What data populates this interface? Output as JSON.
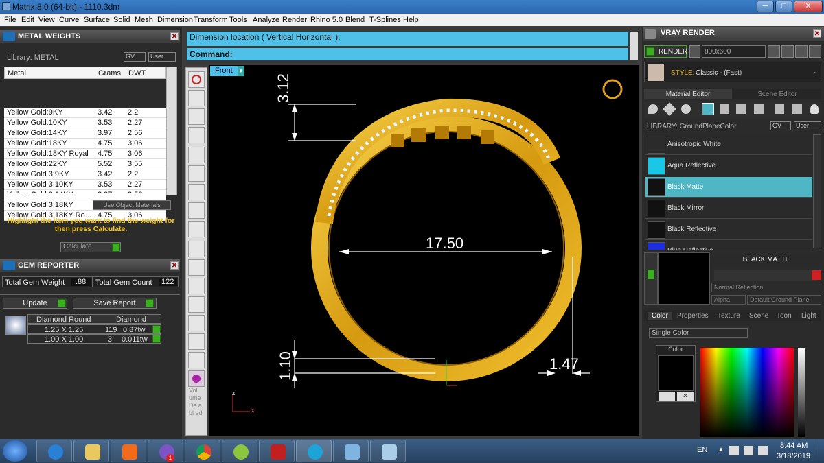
{
  "window": {
    "title": "Matrix 8.0 (64-bit) - 1110.3dm",
    "min": "─",
    "max": "□",
    "close": "✕"
  },
  "menu": [
    "File",
    "Edit",
    "View",
    "Curve",
    "Surface",
    "Solid",
    "Mesh",
    "Dimension",
    "Transform",
    "Tools",
    "Analyze",
    "Render",
    "Rhino 5.0",
    "Blend",
    "T-Splines",
    "Help"
  ],
  "metal_weights": {
    "title": "METAL WEIGHTS",
    "library": "Library: METAL",
    "gv": "GV",
    "user": "User",
    "columns": [
      "Metal",
      "Grams",
      "DWT"
    ],
    "rows": [
      [
        "Yellow Gold:9KY",
        "3.42",
        "2.2"
      ],
      [
        "Yellow Gold:10KY",
        "3.53",
        "2.27"
      ],
      [
        "Yellow Gold:14KY",
        "3.97",
        "2.56"
      ],
      [
        "Yellow Gold:18KY",
        "4.75",
        "3.06"
      ],
      [
        "Yellow Gold:18KY Royal",
        "4.75",
        "3.06"
      ],
      [
        "Yellow Gold:22KY",
        "5.52",
        "3.55"
      ],
      [
        "Yellow Gold 3:9KY",
        "3.42",
        "2.2"
      ],
      [
        "Yellow Gold 3:10KY",
        "3.53",
        "2.27"
      ],
      [
        "Yellow Gold 3:14KY",
        "3.97",
        "2.56"
      ],
      [
        "Yellow Gold 3:18KY",
        "4.75",
        "3.06"
      ],
      [
        "Yellow Gold 3:18KY Ro...",
        "4.75",
        "3.06"
      ]
    ],
    "use_object": "Use Object Materials",
    "hint": "Highlight the item you want to find the weight for then press Calculate.",
    "calculate": "Calculate"
  },
  "gem_reporter": {
    "title": "GEM REPORTER",
    "total_weight_label": "Total Gem Weight",
    "total_weight": ".88",
    "total_count_label": "Total Gem Count",
    "total_count": "122",
    "update": "Update",
    "save": "Save Report",
    "col1": "Diamond Round",
    "col2": "Diamond",
    "rows": [
      [
        "1.25 X 1.25",
        "119",
        "0.87tw"
      ],
      [
        "1.00 X 1.00",
        "3",
        "0.011tw"
      ]
    ]
  },
  "command": {
    "prompt": "Dimension location ( Vertical  Horizontal ):",
    "label": "Command:"
  },
  "viewport": {
    "name": "Front",
    "dims": {
      "top": "3.12",
      "inner": "17.50",
      "bottom": "1.10",
      "side": "1.47"
    },
    "axis_z": "z",
    "axis_x": "x"
  },
  "side_toolbar": {
    "volume_text": "Vol ume De abl ed"
  },
  "vray": {
    "title": "VRAY RENDER",
    "render": "RENDER",
    "resolution": "800x600",
    "style_label": "STYLE:",
    "style": "Classic - (Fast)",
    "tabs": [
      "Material Editor",
      "Scene Editor"
    ],
    "library": "LIBRARY: GroundPlaneColor",
    "gv": "GV",
    "user": "User",
    "materials": [
      {
        "name": "Anisotropic White",
        "color": "#2b2b2b"
      },
      {
        "name": "Aqua Reflective",
        "color": "#19c8e6"
      },
      {
        "name": "Black Matte",
        "color": "#111111"
      },
      {
        "name": "Black Mirror",
        "color": "#111111"
      },
      {
        "name": "Black Reflective",
        "color": "#111111"
      },
      {
        "name": "Blue Reflective",
        "color": "#1c2ee0"
      }
    ],
    "selected_name": "BLACK MATTE",
    "reflection": "Normal Reflection",
    "alpha": "Alpha",
    "ground": "Default Ground Plane",
    "bottom_tabs": [
      "Color",
      "Properties",
      "Texture",
      "Scene",
      "Toon",
      "Light"
    ],
    "color_mode": "Single Color",
    "color_label": "Color"
  },
  "taskbar": {
    "lang": "EN",
    "time": "8:44 AM",
    "date": "3/18/2019",
    "badge": "1"
  },
  "colors": {
    "accent": "#4fc1e9",
    "gold": "#e8b21a",
    "green": "#3cae22",
    "selected": "#4fb6c6"
  }
}
